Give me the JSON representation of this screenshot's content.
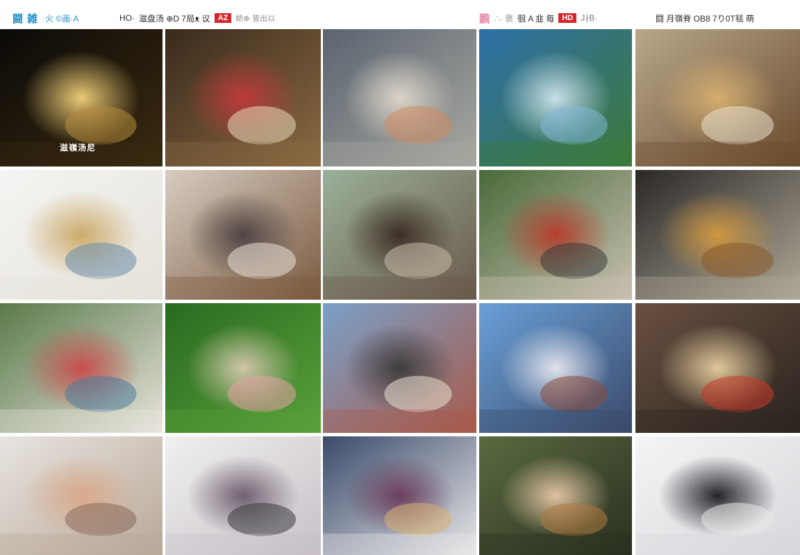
{
  "header": {
    "seg1": {
      "brand": "闘 雑",
      "sub": "·火 ©画·A"
    },
    "seg2": {
      "text1": "HO·",
      "text2": "滋盘汤 ⊕D 7局ᴥ 议",
      "badge": "AZ",
      "text3": "紡⊕·皆出以"
    },
    "seg3": {
      "brand": "飜",
      "text1": "∴· 褒",
      "text2": "徊 A 韭 毎",
      "badge": "HD",
      "text3": "J∤B·"
    },
    "seg4": {
      "text": "闘 月嶺脊 OB8 7り0T毯 萌"
    }
  },
  "tiles": [
    {
      "label": "glowing-wire-sculpture",
      "caption": "滋嶺汤尼"
    },
    {
      "label": "strawberry-dessert-basket",
      "caption": ""
    },
    {
      "label": "furry-creature-portrait",
      "caption": ""
    },
    {
      "label": "river-landscape",
      "caption": ""
    },
    {
      "label": "food-spread-table",
      "caption": ""
    },
    {
      "label": "glass-bottles",
      "caption": ""
    },
    {
      "label": "hat-wearing-figure",
      "caption": ""
    },
    {
      "label": "creature-in-coat",
      "caption": ""
    },
    {
      "label": "garden-machinery",
      "caption": ""
    },
    {
      "label": "pasta-dishes",
      "caption": ""
    },
    {
      "label": "papers-on-table",
      "caption": ""
    },
    {
      "label": "flower-on-grass",
      "caption": ""
    },
    {
      "label": "city-street-scene",
      "caption": ""
    },
    {
      "label": "mountain-lake-boat",
      "caption": ""
    },
    {
      "label": "interior-hall",
      "caption": ""
    },
    {
      "label": "hands-closeup",
      "caption": ""
    },
    {
      "label": "book-collage",
      "caption": ""
    },
    {
      "label": "shop-display",
      "caption": ""
    },
    {
      "label": "woman-portrait",
      "caption": ""
    },
    {
      "label": "feathered-sculpture",
      "caption": ""
    }
  ]
}
